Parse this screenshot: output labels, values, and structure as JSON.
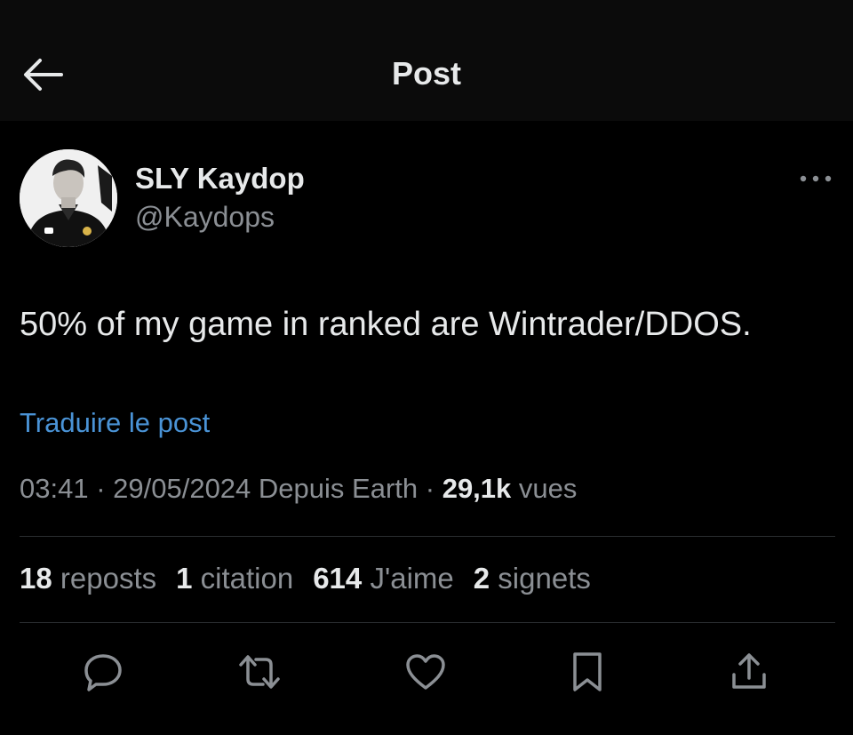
{
  "header": {
    "title": "Post",
    "back_icon": "arrow-left-icon"
  },
  "author": {
    "display_name": "SLY Kaydop",
    "handle": "@Kaydops",
    "more_icon": "more-horizontal-icon"
  },
  "post": {
    "text": "50% of my game in ranked are Wintrader/DDOS.",
    "translate_label": "Traduire le post"
  },
  "meta": {
    "time": "03:41",
    "date": "29/05/2024",
    "location": "Depuis Earth",
    "views_count": "29,1k",
    "views_label": "vues"
  },
  "stats": {
    "reposts_count": "18",
    "reposts_label": "reposts",
    "quotes_count": "1",
    "quotes_label": "citation",
    "likes_count": "614",
    "likes_label": "J'aime",
    "bookmarks_count": "2",
    "bookmarks_label": "signets"
  },
  "actions": [
    "reply-icon",
    "repost-icon",
    "like-icon",
    "bookmark-icon",
    "share-icon"
  ],
  "colors": {
    "background": "#000000",
    "header": "#0b0b0b",
    "link": "#4a93d6",
    "secondary_text": "#8b8f94",
    "primary_text": "#e7e9ea"
  }
}
